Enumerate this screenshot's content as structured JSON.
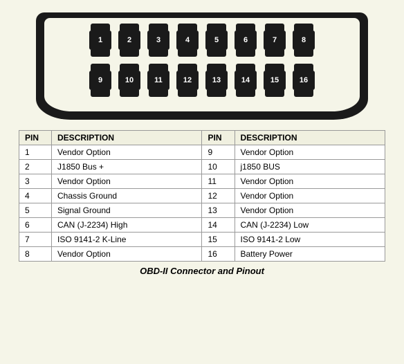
{
  "connector": {
    "top_pins": [
      1,
      2,
      3,
      4,
      5,
      6,
      7,
      8
    ],
    "bottom_pins": [
      9,
      10,
      11,
      12,
      13,
      14,
      15,
      16
    ]
  },
  "table": {
    "headers": [
      "PIN",
      "DESCRIPTION",
      "PIN",
      "DESCRIPTION"
    ],
    "rows": [
      {
        "pin1": "1",
        "desc1": "Vendor Option",
        "pin2": "9",
        "desc2": "Vendor Option"
      },
      {
        "pin1": "2",
        "desc1": "J1850 Bus +",
        "pin2": "10",
        "desc2": "j1850 BUS"
      },
      {
        "pin1": "3",
        "desc1": "Vendor Option",
        "pin2": "11",
        "desc2": "Vendor Option"
      },
      {
        "pin1": "4",
        "desc1": "Chassis Ground",
        "pin2": "12",
        "desc2": "Vendor Option"
      },
      {
        "pin1": "5",
        "desc1": "Signal Ground",
        "pin2": "13",
        "desc2": "Vendor Option"
      },
      {
        "pin1": "6",
        "desc1": "CAN (J-2234) High",
        "pin2": "14",
        "desc2": "CAN (J-2234) Low"
      },
      {
        "pin1": "7",
        "desc1": "ISO 9141-2 K-Line",
        "pin2": "15",
        "desc2": "ISO 9141-2 Low"
      },
      {
        "pin1": "8",
        "desc1": "Vendor Option",
        "pin2": "16",
        "desc2": "Battery Power"
      }
    ]
  },
  "caption": "OBD-II Connector and Pinout"
}
